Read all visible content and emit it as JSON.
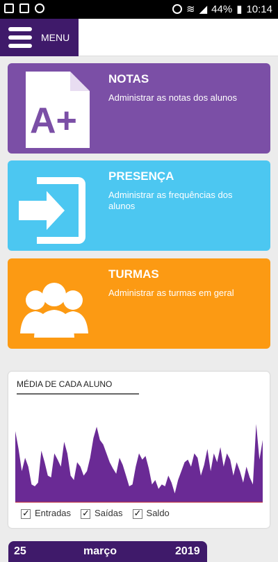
{
  "status": {
    "battery": "44%",
    "time": "10:14"
  },
  "header": {
    "menu_label": "MENU"
  },
  "cards": [
    {
      "title": "NOTAS",
      "desc": "Administrar as notas dos alunos",
      "icon": "grade-document-icon",
      "color": "#7b4fa6"
    },
    {
      "title": "PRESENÇA",
      "desc": "Administrar as frequências dos alunos",
      "icon": "sign-in-icon",
      "color": "#4cc7f1"
    },
    {
      "title": "TURMAS",
      "desc": "Administrar as turmas em geral",
      "icon": "group-users-icon",
      "color": "#fc9a13"
    }
  ],
  "chart_card": {
    "title": "MÉDIA DE CADA ALUNO",
    "legend": [
      "Entradas",
      "Saídas",
      "Saldo"
    ]
  },
  "chart_data": {
    "type": "area",
    "title": "MÉDIA DE CADA ALUNO",
    "series": [
      {
        "name": "Entradas",
        "color": "#6a2a95",
        "values": [
          80,
          60,
          35,
          50,
          40,
          20,
          18,
          22,
          58,
          45,
          30,
          28,
          55,
          48,
          40,
          68,
          55,
          30,
          25,
          45,
          40,
          30,
          35,
          50,
          72,
          85,
          70,
          65,
          55,
          45,
          38,
          32,
          50,
          42,
          30,
          18,
          20,
          40,
          55,
          48,
          52,
          38,
          20,
          25,
          15,
          20,
          18,
          30,
          22,
          10,
          25,
          35,
          45,
          48,
          40,
          55,
          50,
          30,
          42,
          60,
          35,
          55,
          45,
          62,
          40,
          55,
          48,
          30,
          45,
          35,
          22,
          40,
          28,
          20,
          88,
          48,
          70
        ]
      }
    ],
    "ylim": [
      0,
      100
    ]
  },
  "date_bar": {
    "day": "25",
    "month": "março",
    "year": "2019"
  }
}
